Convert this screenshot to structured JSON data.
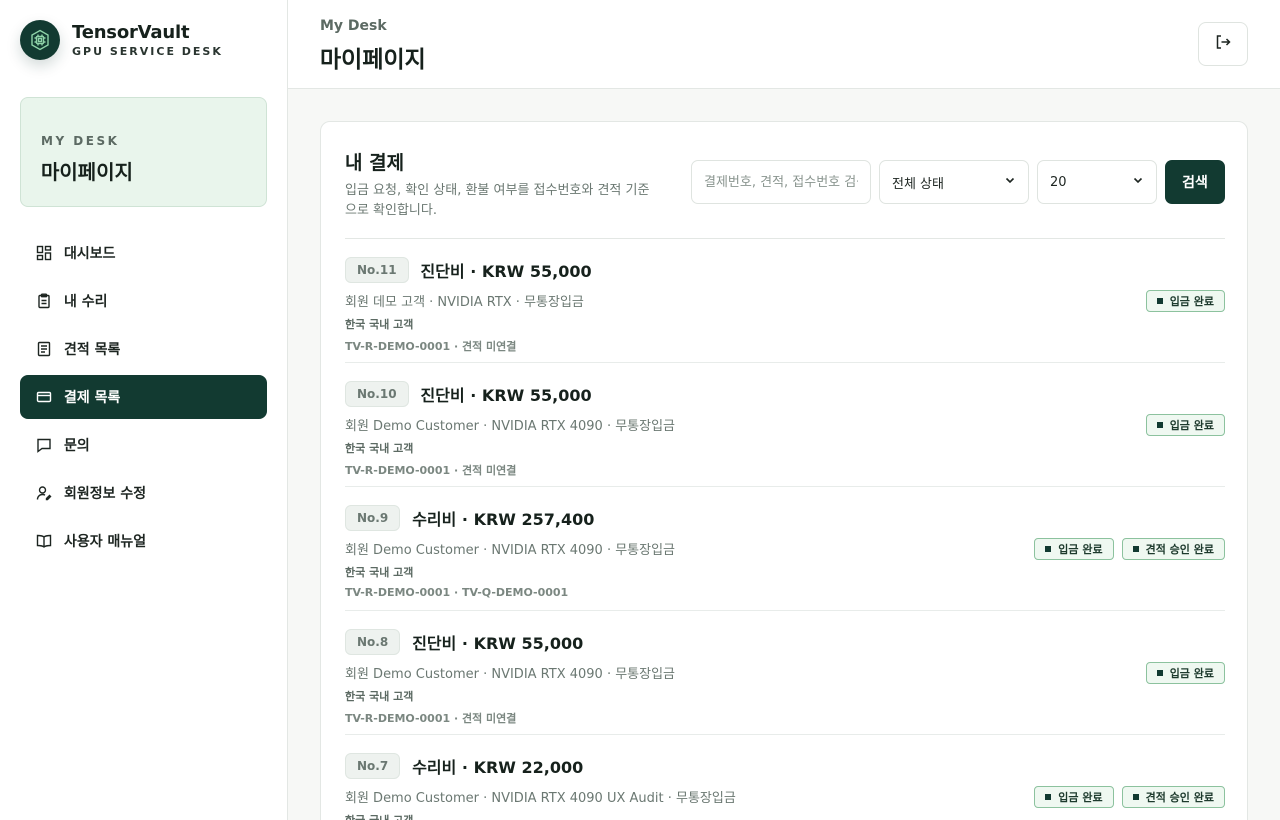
{
  "brand": {
    "name": "TensorVault",
    "subtitle": "GPU SERVICE DESK"
  },
  "desk": {
    "kicker": "MY DESK",
    "title": "마이페이지"
  },
  "nav": [
    {
      "label": "대시보드",
      "icon": "dashboard-icon",
      "active": false
    },
    {
      "label": "내 수리",
      "icon": "clipboard-icon",
      "active": false
    },
    {
      "label": "견적 목록",
      "icon": "document-icon",
      "active": false
    },
    {
      "label": "결제 목록",
      "icon": "credit-card-icon",
      "active": true
    },
    {
      "label": "문의",
      "icon": "message-icon",
      "active": false
    },
    {
      "label": "회원정보 수정",
      "icon": "user-edit-icon",
      "active": false
    },
    {
      "label": "사용자 매뉴얼",
      "icon": "book-icon",
      "active": false
    }
  ],
  "header": {
    "kicker": "My Desk",
    "title": "마이페이지"
  },
  "payments": {
    "title": "내 결제",
    "description": "입금 요청, 확인 상태, 환불 여부를 접수번호와 견적 기준으로 확인합니다.",
    "search_placeholder": "결제번호, 견적, 접수번호 검색",
    "status_filter": "전체 상태",
    "page_size": "20",
    "search_button": "검색",
    "items": [
      {
        "no": "No.11",
        "title": "진단비 · KRW 55,000",
        "meta": "회원 데모 고객 · NVIDIA RTX · 무통장입금",
        "customer": "한국 국내 고객",
        "ref": "TV-R-DEMO-0001 · 견적 미연결",
        "badges": [
          "입금 완료"
        ]
      },
      {
        "no": "No.10",
        "title": "진단비 · KRW 55,000",
        "meta": "회원 Demo Customer · NVIDIA RTX 4090 · 무통장입금",
        "customer": "한국 국내 고객",
        "ref": "TV-R-DEMO-0001 · 견적 미연결",
        "badges": [
          "입금 완료"
        ]
      },
      {
        "no": "No.9",
        "title": "수리비 · KRW 257,400",
        "meta": "회원 Demo Customer · NVIDIA RTX 4090 · 무통장입금",
        "customer": "한국 국내 고객",
        "ref": "TV-R-DEMO-0001 · TV-Q-DEMO-0001",
        "badges": [
          "입금 완료",
          "견적 승인 완료"
        ]
      },
      {
        "no": "No.8",
        "title": "진단비 · KRW 55,000",
        "meta": "회원 Demo Customer · NVIDIA RTX 4090 · 무통장입금",
        "customer": "한국 국내 고객",
        "ref": "TV-R-DEMO-0001 · 견적 미연결",
        "badges": [
          "입금 완료"
        ]
      },
      {
        "no": "No.7",
        "title": "수리비 · KRW 22,000",
        "meta": "회원 Demo Customer · NVIDIA RTX 4090 UX Audit · 무통장입금",
        "customer": "한국 국내 고객",
        "ref": "",
        "badges": [
          "입금 완료",
          "견적 승인 완료"
        ]
      }
    ]
  }
}
